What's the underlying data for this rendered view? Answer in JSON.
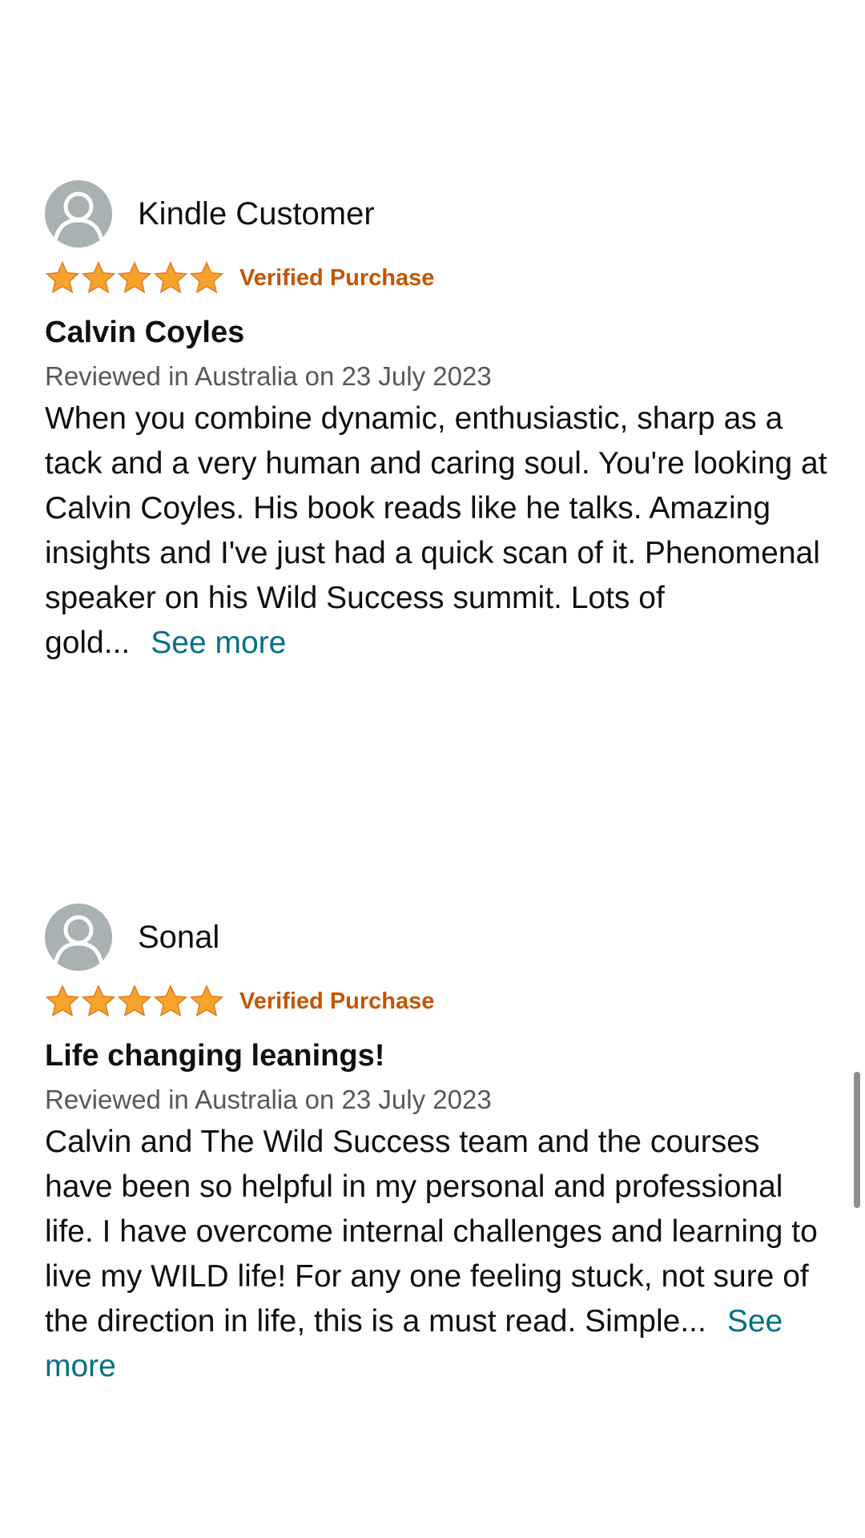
{
  "colors": {
    "verified": "#c45500",
    "link": "#007185",
    "star": "#f7a32c",
    "avatar_bg": "#a8b2b2"
  },
  "reviews": [
    {
      "reviewer": "Kindle Customer",
      "rating": 5,
      "rating_max": 5,
      "verified_label": "Verified Purchase",
      "title": "Calvin Coyles",
      "date": "Reviewed in Australia on 23 July 2023",
      "body": "When you combine dynamic, enthusiastic, sharp as a tack and a very human and caring soul. You're looking at Calvin Coyles. His book reads like he talks. Amazing insights and I've just had a quick scan of it. Phenomenal speaker on his Wild Success summit. Lots of gold...",
      "see_more": "See more",
      "avatar_icon": "user-silhouette-icon"
    },
    {
      "reviewer": "Sonal",
      "rating": 5,
      "rating_max": 5,
      "verified_label": "Verified Purchase",
      "title": "Life changing leanings!",
      "date": "Reviewed in Australia on 23 July 2023",
      "body": "Calvin and The Wild Success team and the courses have been so helpful in my personal and professional life. I have overcome internal challenges and learning to live my WILD life! For any one feeling stuck, not sure of the direction in life, this is a must read. Simple...",
      "see_more": "See more",
      "avatar_icon": "user-silhouette-icon"
    }
  ]
}
